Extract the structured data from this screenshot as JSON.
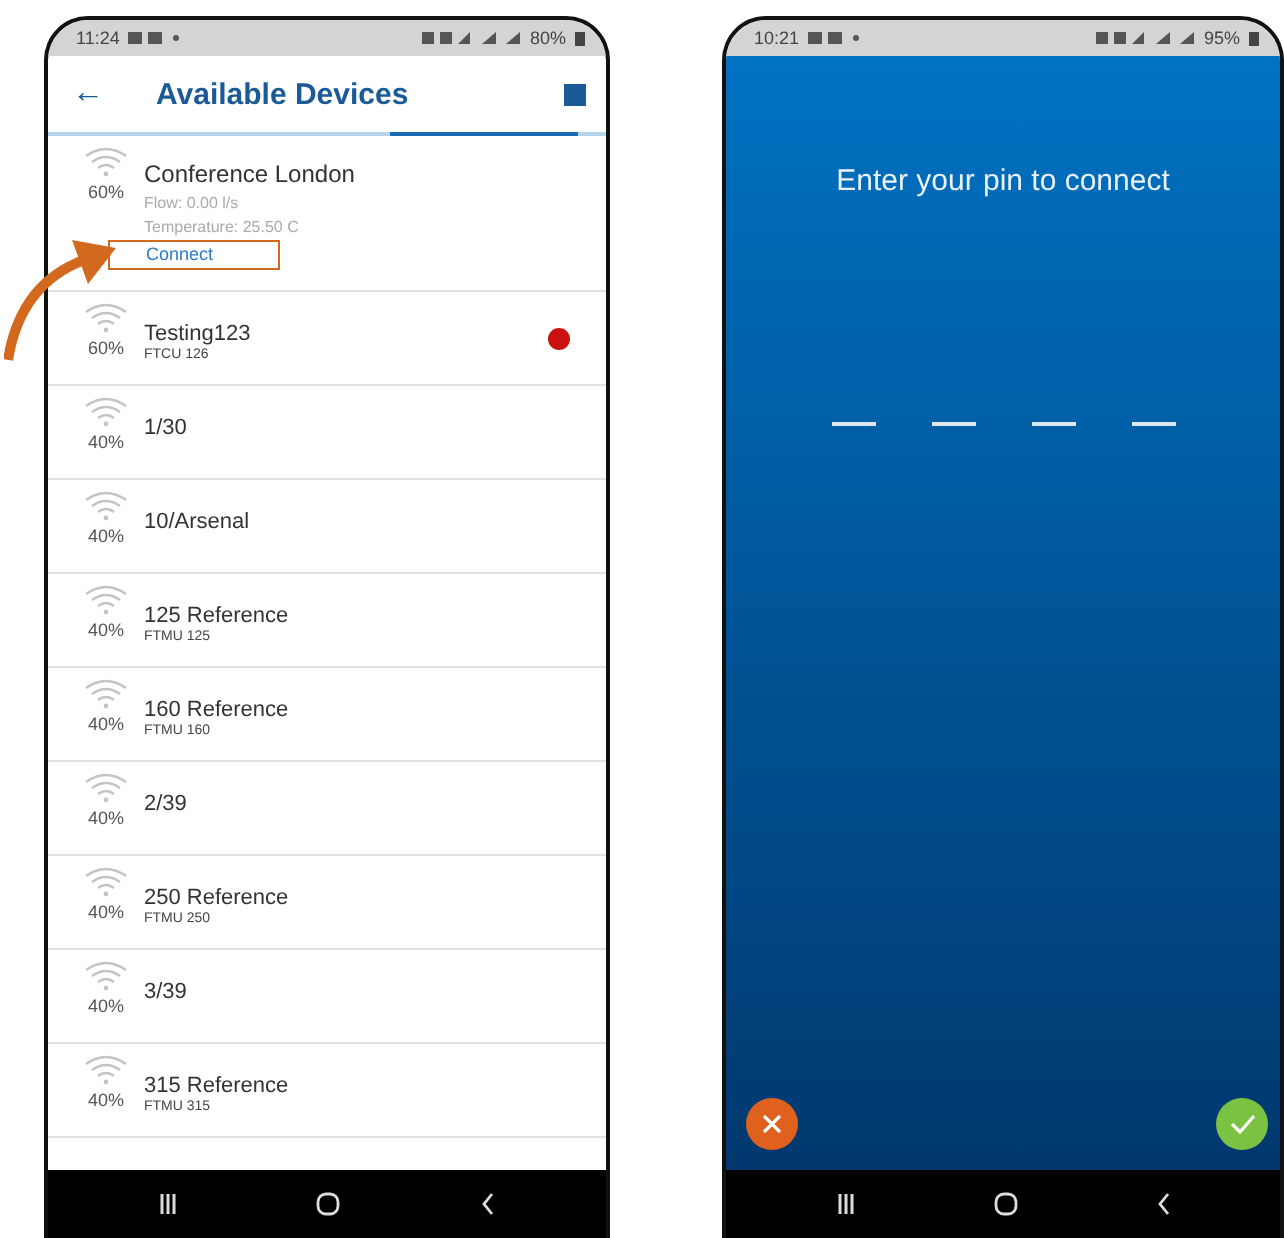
{
  "phones": [
    {
      "status_bar": {
        "time": "11:24",
        "battery": "80%"
      },
      "header": {
        "back": "←",
        "title": "Available Devices"
      },
      "devices": [
        {
          "signal": "60%",
          "name": "Conference London",
          "details": [
            "Flow: 0.00 l/s",
            "Temperature: 25.50 C"
          ],
          "action": "Connect",
          "expanded": true,
          "alert": false
        },
        {
          "signal": "60%",
          "name": "Testing123",
          "subtitle": "FTCU 126",
          "expanded": false,
          "alert": true
        },
        {
          "signal": "40%",
          "name": "1/30",
          "expanded": false,
          "alert": false
        },
        {
          "signal": "40%",
          "name": "10/Arsenal",
          "expanded": false,
          "alert": false
        },
        {
          "signal": "40%",
          "name": "125 Reference",
          "subtitle": "FTMU 125",
          "expanded": false,
          "alert": false
        },
        {
          "signal": "40%",
          "name": "160 Reference",
          "subtitle": "FTMU 160",
          "expanded": false,
          "alert": false
        },
        {
          "signal": "40%",
          "name": "2/39",
          "expanded": false,
          "alert": false
        },
        {
          "signal": "40%",
          "name": "250 Reference",
          "subtitle": "FTMU 250",
          "expanded": false,
          "alert": false
        },
        {
          "signal": "40%",
          "name": "3/39",
          "expanded": false,
          "alert": false
        },
        {
          "signal": "40%",
          "name": "315 Reference",
          "subtitle": "FTMU 315",
          "expanded": false,
          "alert": false
        }
      ]
    },
    {
      "status_bar": {
        "time": "10:21",
        "battery": "95%"
      },
      "prompt": "Enter your pin to connect",
      "pin_slots": [
        {
          "filled": false
        },
        {
          "filled": false
        },
        {
          "filled": false
        },
        {
          "filled": false
        }
      ]
    }
  ]
}
